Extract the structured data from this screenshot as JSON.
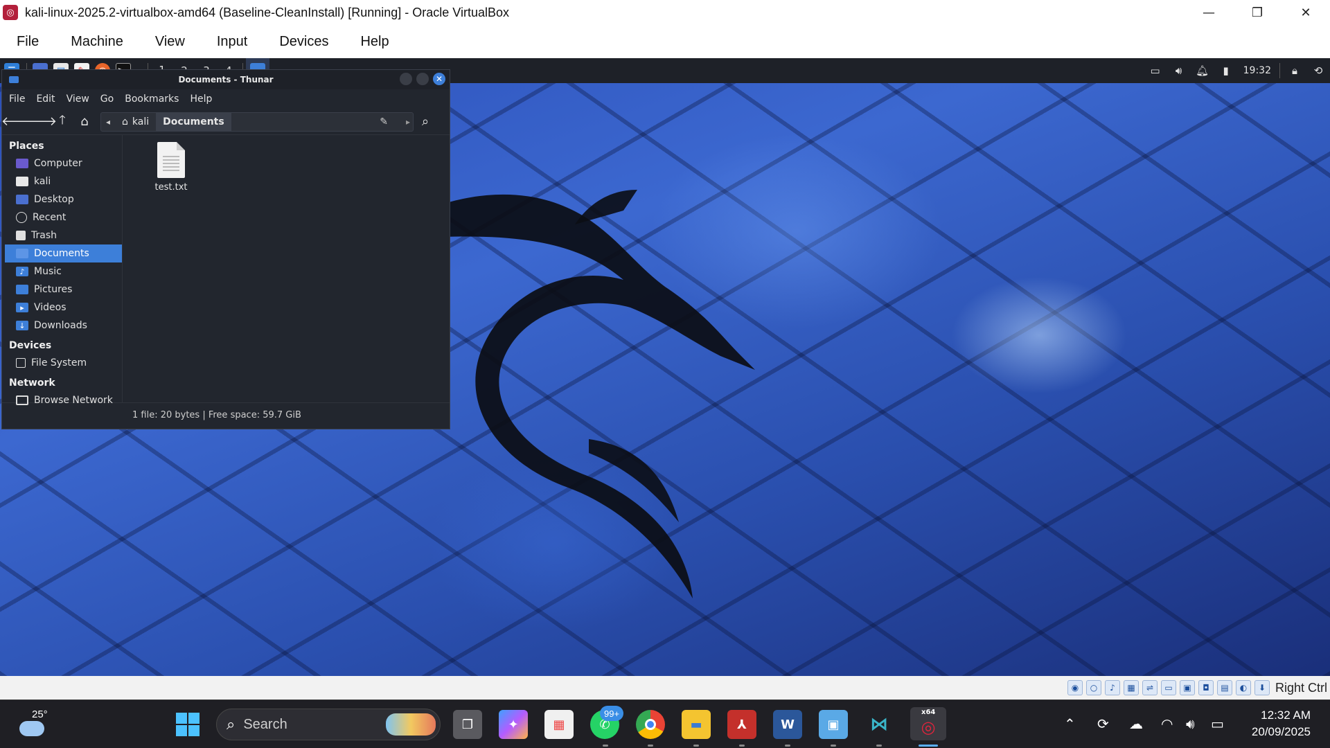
{
  "host_window": {
    "title": "kali-linux-2025.2-virtualbox-amd64 (Baseline-CleanInstall) [Running] - Oracle VirtualBox",
    "controls": {
      "minimize": "—",
      "maximize": "❐",
      "close": "✕"
    },
    "menu": [
      "File",
      "Machine",
      "View",
      "Input",
      "Devices",
      "Help"
    ]
  },
  "kali_panel": {
    "workspaces": [
      "1",
      "2",
      "3",
      "4"
    ],
    "clock": "19:32"
  },
  "thunar": {
    "title": "Documents - Thunar",
    "menu": [
      "File",
      "Edit",
      "View",
      "Go",
      "Bookmarks",
      "Help"
    ],
    "path": [
      "kali",
      "Documents"
    ],
    "sidebar": {
      "places_header": "Places",
      "places": [
        "Computer",
        "kali",
        "Desktop",
        "Recent",
        "Trash",
        "Documents",
        "Music",
        "Pictures",
        "Videos",
        "Downloads"
      ],
      "devices_header": "Devices",
      "devices": [
        "File System"
      ],
      "network_header": "Network",
      "network": [
        "Browse Network"
      ]
    },
    "files": [
      {
        "name": "test.txt"
      }
    ],
    "status": "1 file: 20 bytes  |  Free space: 59.7 GiB"
  },
  "vbox_status": {
    "host_key": "Right Ctrl"
  },
  "taskbar": {
    "weather_temp": "25°",
    "search_placeholder": "Search",
    "whatsapp_badge": "99+",
    "word_label": "W",
    "vbox_label": "x64",
    "time": "12:32 AM",
    "date": "20/09/2025"
  }
}
